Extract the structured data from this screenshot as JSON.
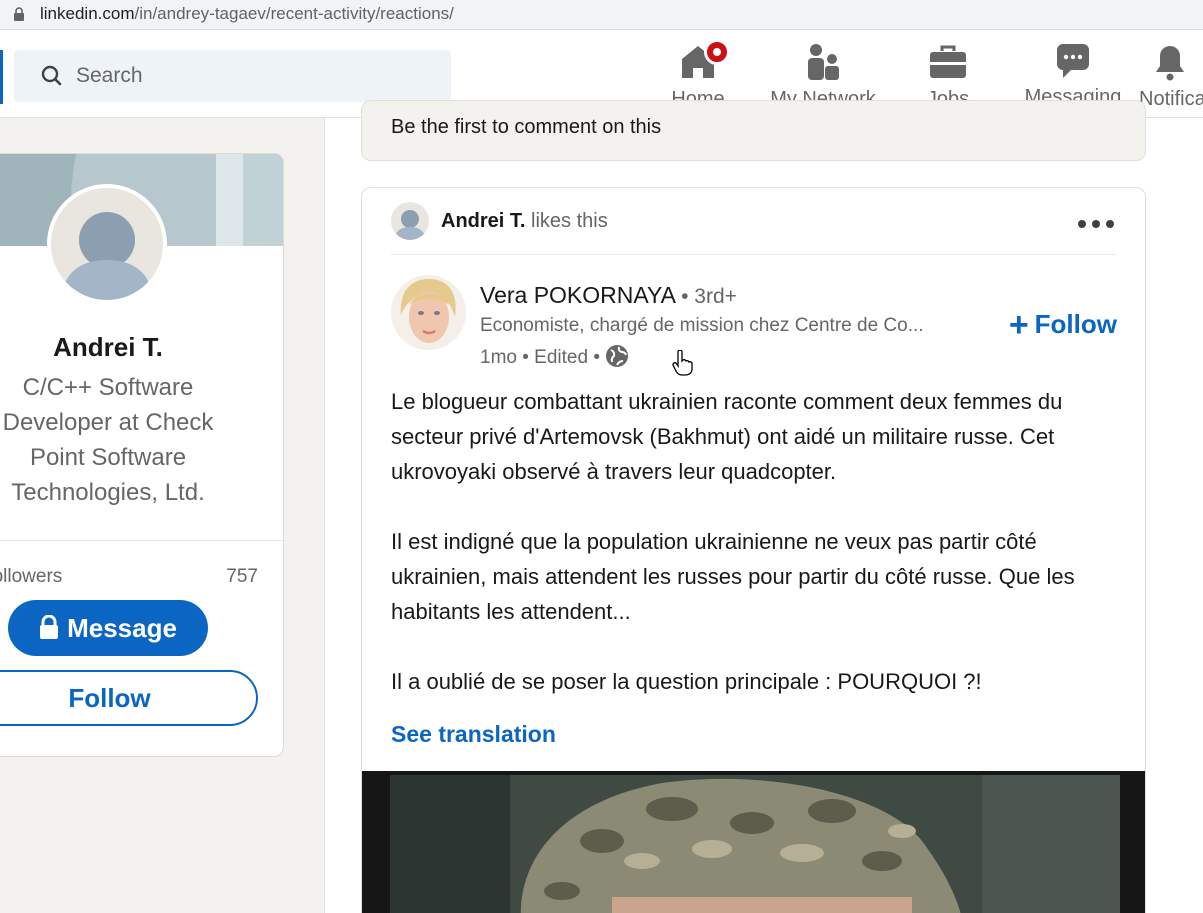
{
  "browser": {
    "url_host": "linkedin.com",
    "url_path": "/in/andrey-tagaev/recent-activity/reactions/"
  },
  "search": {
    "placeholder": "Search"
  },
  "nav": {
    "items": [
      {
        "label": "Home",
        "icon": "home-icon",
        "has_badge": true
      },
      {
        "label": "My Network",
        "icon": "network-icon"
      },
      {
        "label": "Jobs",
        "icon": "briefcase-icon"
      },
      {
        "label": "Messaging",
        "icon": "messaging-icon"
      },
      {
        "label": "Notifications",
        "icon": "bell-icon"
      }
    ]
  },
  "profile": {
    "name": "Andrei T.",
    "headline": "C/C++ Software Developer at Check Point Software Technologies, Ltd.",
    "followers_label": "Followers",
    "followers_count": "757",
    "message_label": "Message",
    "follow_label": "Follow"
  },
  "previous_post": {
    "comment_prompt": "Be the first to comment on this"
  },
  "post": {
    "liker_name": "Andrei T.",
    "liker_action": "likes this",
    "author_name": "Vera POKORNAYA",
    "author_degree": "• 3rd+",
    "author_headline": "Economiste, chargé de mission chez Centre de Co...",
    "meta": "1mo • Edited •",
    "follow_label": "Follow",
    "paragraphs": [
      "Le blogueur combattant ukrainien raconte comment deux femmes du secteur privé d'Artemovsk (Bakhmut) ont aidé un militaire russe. Cet ukrovoyaki observé à travers leur quadcopter.",
      "Il est indigné que la population ukrainienne ne veux pas partir côté ukrainien, mais attendent les russes pour partir du côté russe. Que les habitants les attendent...",
      "Il a oublié de se poser la question principale : POURQUOI ?!"
    ],
    "see_translation": "See translation"
  },
  "colors": {
    "brand": "#0a66c2",
    "badge": "#cc1016",
    "page_bg": "#f3f2ef"
  }
}
